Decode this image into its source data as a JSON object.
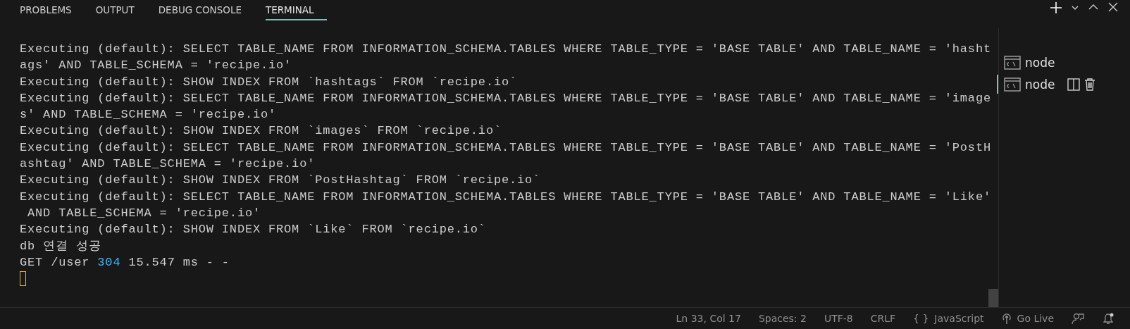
{
  "panel_tabs": [
    {
      "label": "PROBLEMS",
      "selected": false
    },
    {
      "label": "OUTPUT",
      "selected": false
    },
    {
      "label": "DEBUG CONSOLE",
      "selected": false
    },
    {
      "label": "TERMINAL",
      "selected": true
    }
  ],
  "terminal_lines": [
    [
      {
        "kind": "plain",
        "text": "Executing (default): SELECT TABLE_NAME FROM INFORMATION_SCHEMA.TABLES WHERE TABLE_TYPE = 'BASE TABLE' AND TABLE_NAME = 'hasht"
      }
    ],
    [
      {
        "kind": "plain",
        "text": "ags' AND TABLE_SCHEMA = 'recipe.io'"
      }
    ],
    [
      {
        "kind": "plain",
        "text": "Executing (default): SHOW INDEX FROM `hashtags` FROM `recipe.io`"
      }
    ],
    [
      {
        "kind": "plain",
        "text": "Executing (default): SELECT TABLE_NAME FROM INFORMATION_SCHEMA.TABLES WHERE TABLE_TYPE = 'BASE TABLE' AND TABLE_NAME = 'image"
      }
    ],
    [
      {
        "kind": "plain",
        "text": "s' AND TABLE_SCHEMA = 'recipe.io'"
      }
    ],
    [
      {
        "kind": "plain",
        "text": "Executing (default): SHOW INDEX FROM `images` FROM `recipe.io`"
      }
    ],
    [
      {
        "kind": "plain",
        "text": "Executing (default): SELECT TABLE_NAME FROM INFORMATION_SCHEMA.TABLES WHERE TABLE_TYPE = 'BASE TABLE' AND TABLE_NAME = 'PostH"
      }
    ],
    [
      {
        "kind": "plain",
        "text": "ashtag' AND TABLE_SCHEMA = 'recipe.io'"
      }
    ],
    [
      {
        "kind": "plain",
        "text": "Executing (default): SHOW INDEX FROM `PostHashtag` FROM `recipe.io`"
      }
    ],
    [
      {
        "kind": "plain",
        "text": "Executing (default): SELECT TABLE_NAME FROM INFORMATION_SCHEMA.TABLES WHERE TABLE_TYPE = 'BASE TABLE' AND TABLE_NAME = 'Like'"
      }
    ],
    [
      {
        "kind": "plain",
        "text": " AND TABLE_SCHEMA = 'recipe.io'"
      }
    ],
    [
      {
        "kind": "plain",
        "text": "Executing (default): SHOW INDEX FROM `Like` FROM `recipe.io`"
      }
    ],
    [
      {
        "kind": "plain",
        "text": "db 연결 성공"
      }
    ],
    [
      {
        "kind": "plain",
        "text": "GET /user "
      },
      {
        "kind": "number",
        "text": "304"
      },
      {
        "kind": "plain",
        "text": " 15.547 ms - -"
      }
    ]
  ],
  "terminals": [
    {
      "label": "node",
      "selected": false
    },
    {
      "label": "node",
      "selected": true
    }
  ],
  "status_bar": [
    {
      "kind": "text",
      "label": "Ln 33, Col 17"
    },
    {
      "kind": "text",
      "label": "Spaces: 2"
    },
    {
      "kind": "text",
      "label": "UTF-8"
    },
    {
      "kind": "text",
      "label": "CRLF"
    },
    {
      "kind": "language",
      "icon": "{ }",
      "label": "JavaScript"
    },
    {
      "kind": "live",
      "label": "Go Live"
    },
    {
      "kind": "feedback"
    },
    {
      "kind": "bell"
    }
  ]
}
